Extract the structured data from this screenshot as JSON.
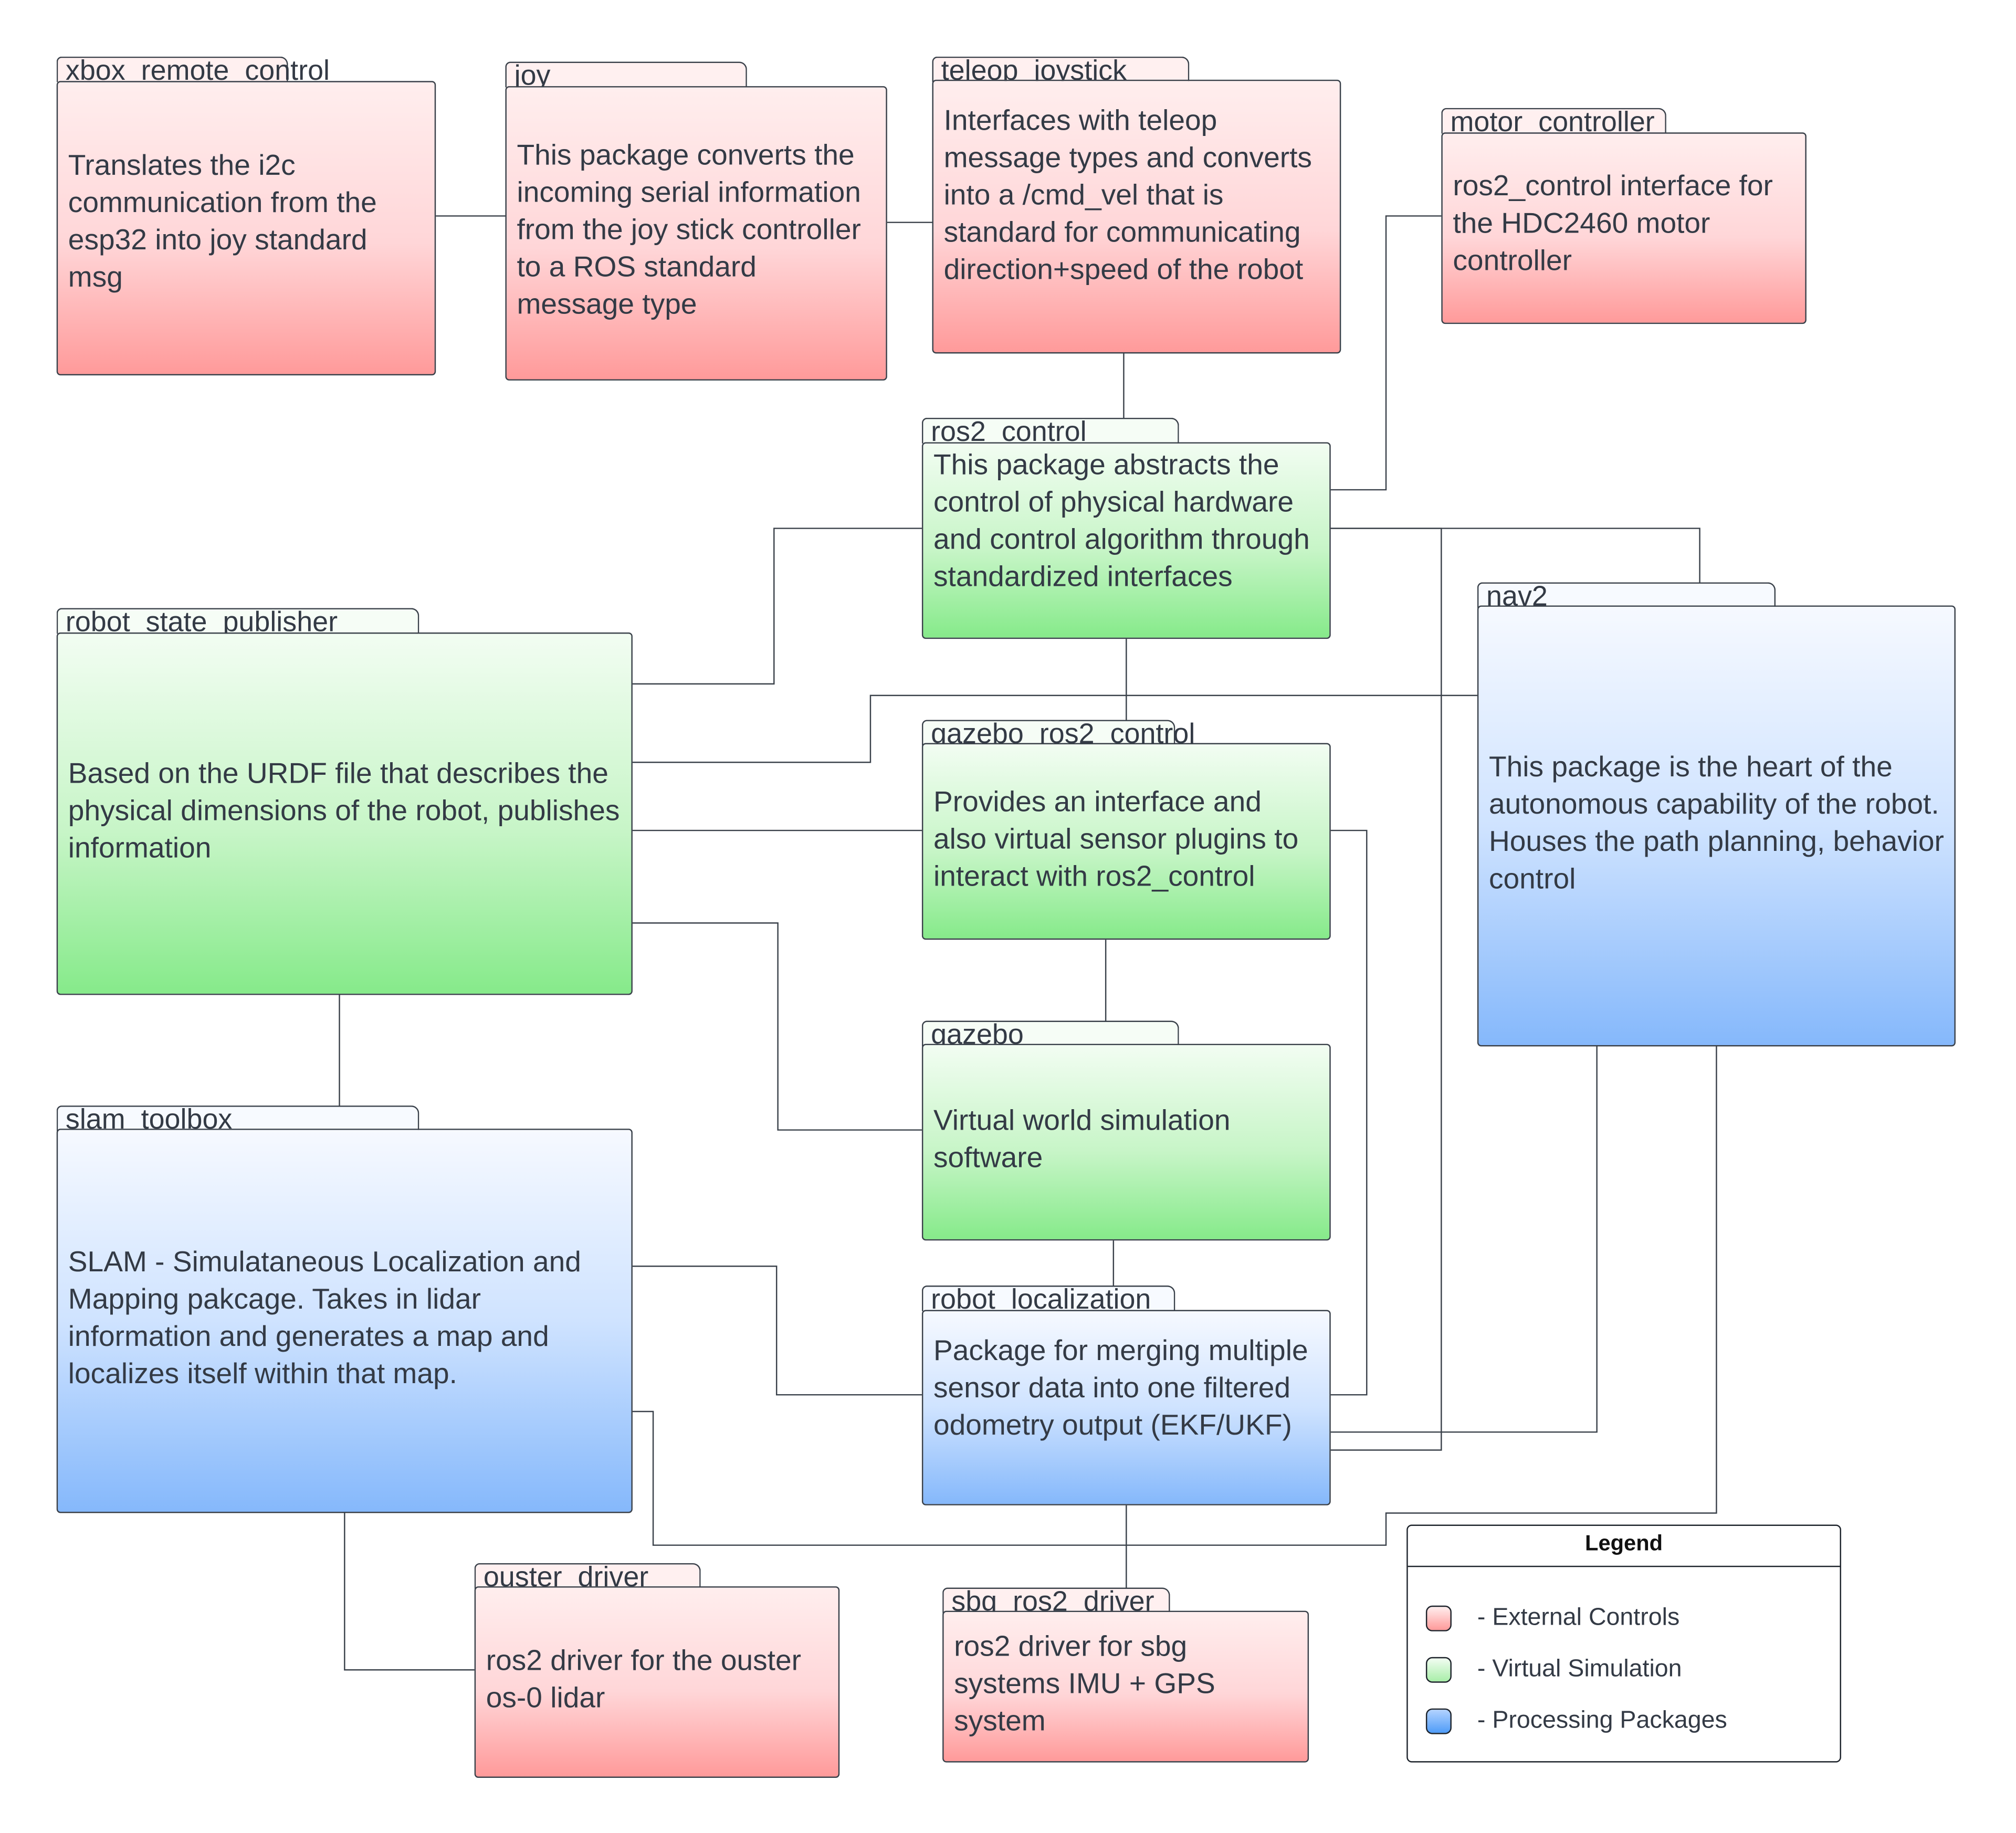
{
  "diagram": {
    "type": "ros2-package-architecture",
    "packages": [
      {
        "id": "xbox_remote_control",
        "name": "xbox_remote_control",
        "category": "External Controls",
        "description": "Translates the i2c communication from the esp32 into joy standard msg"
      },
      {
        "id": "joy",
        "name": "joy",
        "category": "External Controls",
        "description": "This package converts the incoming serial information from the joy stick controller to a ROS standard message type"
      },
      {
        "id": "teleop_joystick",
        "name": "teleop_joystick",
        "category": "External Controls",
        "description": "Interfaces with teleop message types and converts into a /cmd_vel that is standard for communicating direction+speed of the robot"
      },
      {
        "id": "motor_controller",
        "name": "motor_controller",
        "category": "External Controls",
        "description": "ros2_control interface for the HDC2460 motor controller"
      },
      {
        "id": "ros2_control",
        "name": "ros2_control",
        "category": "Virtual Simulation",
        "description": "This package abstracts the control of physical hardware and control algorithm through standardized interfaces"
      },
      {
        "id": "robot_state_publisher",
        "name": "robot_state_publisher",
        "category": "Virtual Simulation",
        "description": "Based on the URDF file that describes the physical dimensions of the robot, publishes information"
      },
      {
        "id": "gazebo_ros2_control",
        "name": "gazebo_ros2_control",
        "category": "Virtual Simulation",
        "description": "Provides an interface and also virtual sensor plugins to interact with ros2_control"
      },
      {
        "id": "gazebo",
        "name": "gazebo",
        "category": "Virtual Simulation",
        "description": "Virtual world simulation software"
      },
      {
        "id": "nav2",
        "name": "nav2",
        "category": "Processing Packages",
        "description": "This package is the heart of the autonomous capability of the robot. Houses the path planning, behavior control"
      },
      {
        "id": "slam_toolbox",
        "name": "slam_toolbox",
        "category": "Processing Packages",
        "description": "SLAM - Simulataneous Localization and Mapping pakcage. Takes in lidar information and generates a map and localizes itself within that map."
      },
      {
        "id": "robot_localization",
        "name": "robot_localization",
        "category": "Processing Packages",
        "description": "Package for merging multiple sensor data into one filtered odometry output (EKF/UKF)"
      },
      {
        "id": "ouster_driver",
        "name": "ouster_driver",
        "category": "External Controls",
        "description": "ros2 driver for the ouster os-0 lidar"
      },
      {
        "id": "sbg_ros2_driver",
        "name": "sbg_ros2_driver",
        "category": "External Controls",
        "description": "ros2 driver for sbg systems IMU + GPS system"
      }
    ],
    "edges": [
      {
        "from": "xbox_remote_control",
        "to": "joy"
      },
      {
        "from": "joy",
        "to": "teleop_joystick"
      },
      {
        "from": "teleop_joystick",
        "to": "ros2_control"
      },
      {
        "from": "ros2_control",
        "to": "motor_controller"
      },
      {
        "from": "ros2_control",
        "to": "robot_state_publisher"
      },
      {
        "from": "ros2_control",
        "to": "nav2"
      },
      {
        "from": "ros2_control",
        "to": "gazebo_ros2_control"
      },
      {
        "from": "ros2_control",
        "to": "robot_localization"
      },
      {
        "from": "robot_state_publisher",
        "to": "nav2"
      },
      {
        "from": "robot_state_publisher",
        "to": "gazebo_ros2_control"
      },
      {
        "from": "robot_state_publisher",
        "to": "gazebo"
      },
      {
        "from": "robot_state_publisher",
        "to": "slam_toolbox"
      },
      {
        "from": "gazebo_ros2_control",
        "to": "gazebo"
      },
      {
        "from": "gazebo_ros2_control",
        "to": "robot_localization"
      },
      {
        "from": "gazebo",
        "to": "robot_localization"
      },
      {
        "from": "slam_toolbox",
        "to": "robot_localization"
      },
      {
        "from": "slam_toolbox",
        "to": "nav2"
      },
      {
        "from": "slam_toolbox",
        "to": "ouster_driver"
      },
      {
        "from": "nav2",
        "to": "robot_localization"
      },
      {
        "from": "robot_localization",
        "to": "sbg_ros2_driver"
      }
    ]
  },
  "legend": {
    "title": "Legend",
    "items": [
      {
        "label": "-  External Controls",
        "color": "#ff9a9a"
      },
      {
        "label": "-  Virtual Simulation",
        "color": "#86ea8a"
      },
      {
        "label": "-  Processing Packages",
        "color": "#4f9cf8"
      }
    ]
  }
}
